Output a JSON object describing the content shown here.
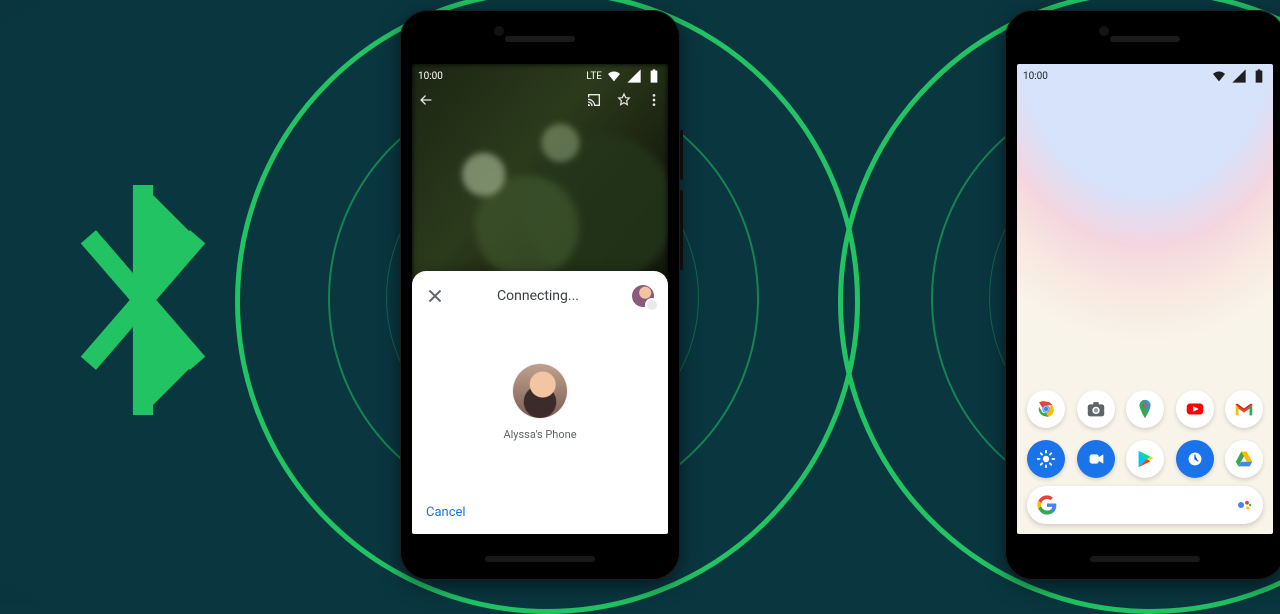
{
  "phone1": {
    "status": {
      "time": "10:00",
      "net_label": "LTE"
    },
    "sheet": {
      "title": "Connecting...",
      "target_name": "Alyssa's Phone",
      "cancel_label": "Cancel"
    }
  },
  "phone2": {
    "status": {
      "time": "10:00"
    },
    "apps_row1": [
      {
        "id": "chrome",
        "label": "Chrome",
        "name": "chrome-icon"
      },
      {
        "id": "camera",
        "label": "Camera",
        "name": "camera-icon"
      },
      {
        "id": "maps",
        "label": "Maps",
        "name": "maps-icon"
      },
      {
        "id": "youtube",
        "label": "YouTube",
        "name": "youtube-icon"
      },
      {
        "id": "gmail",
        "label": "Gmail",
        "name": "gmail-icon"
      }
    ],
    "apps_row2": [
      {
        "id": "settings",
        "label": "Settings",
        "name": "settings-icon"
      },
      {
        "id": "duo",
        "label": "Duo",
        "name": "duo-icon"
      },
      {
        "id": "play",
        "label": "Play",
        "name": "play-store-icon"
      },
      {
        "id": "clock",
        "label": "Clock",
        "name": "clock-icon"
      },
      {
        "id": "drive",
        "label": "Drive",
        "name": "drive-icon"
      }
    ]
  },
  "decor": {
    "bluetooth_color": "#21c363"
  }
}
